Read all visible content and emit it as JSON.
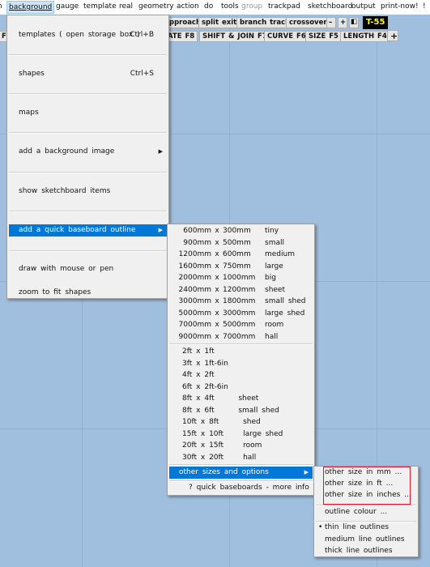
{
  "menubar": {
    "items": [
      {
        "label": "n"
      },
      {
        "label": "background"
      },
      {
        "label": "gauge"
      },
      {
        "label": "template"
      },
      {
        "label": "real"
      },
      {
        "label": "geometry"
      },
      {
        "label": "action"
      },
      {
        "label": "do"
      },
      {
        "label": "tools"
      },
      {
        "label": "group"
      },
      {
        "label": "trackpad"
      },
      {
        "label": "sketchboard"
      },
      {
        "label": "output"
      },
      {
        "label": "print-now!"
      },
      {
        "label": "!"
      }
    ]
  },
  "toolbar1": {
    "approach": "pproach",
    "split_exit": "split exit",
    "branch_track": "branch track",
    "crossover": "crossover",
    "minus": "–",
    "plus": "+",
    "fit": "◧",
    "badge": "T-55",
    "badge_bg": "#000000",
    "badge_fg": "#ffff00"
  },
  "toolbar2": {
    "left": "F|",
    "rotate": "ATE F8",
    "shift_join": "SHIFT & JOIN F7",
    "curve": "CURVE F6",
    "size": "SIZE F5",
    "length": "LENGTH F4",
    "add": "+"
  },
  "background_menu": {
    "items": [
      {
        "label": "templates ( open storage box )",
        "shortcut": "Ctrl+B"
      },
      {
        "label": "shapes",
        "shortcut": "Ctrl+S"
      },
      {
        "label": "maps"
      },
      {
        "label": "add a background image"
      },
      {
        "label": "show sketchboard items"
      },
      {
        "label": "add a quick baseboard outline"
      },
      {
        "label": "draw with mouse or pen"
      },
      {
        "label": "zoom to fit shapes"
      }
    ]
  },
  "baseboard_menu": {
    "metric": [
      {
        "w": "600mm",
        "h": "300mm",
        "name": "tiny"
      },
      {
        "w": "900mm",
        "h": "500mm",
        "name": "small"
      },
      {
        "w": "1200mm",
        "h": "600mm",
        "name": "medium"
      },
      {
        "w": "1600mm",
        "h": "750mm",
        "name": "large"
      },
      {
        "w": "2000mm",
        "h": "1000mm",
        "name": "big"
      },
      {
        "w": "2400mm",
        "h": "1200mm",
        "name": "sheet"
      },
      {
        "w": "3000mm",
        "h": "1800mm",
        "name": "small shed"
      },
      {
        "w": "5000mm",
        "h": "3000mm",
        "name": "large shed"
      },
      {
        "w": "7000mm",
        "h": "5000mm",
        "name": "room"
      },
      {
        "w": "9000mm",
        "h": "7000mm",
        "name": "hall"
      }
    ],
    "imperial": [
      {
        "w": "2ft",
        "h": "1ft",
        "name": ""
      },
      {
        "w": "3ft",
        "h": "1ft-6in",
        "name": ""
      },
      {
        "w": "4ft",
        "h": "2ft",
        "name": ""
      },
      {
        "w": "6ft",
        "h": "2ft-6in",
        "name": ""
      },
      {
        "w": "8ft",
        "h": "4ft",
        "name": "sheet"
      },
      {
        "w": "8ft",
        "h": "6ft",
        "name": "small shed"
      },
      {
        "w": "10ft",
        "h": "8ft",
        "name": "shed"
      },
      {
        "w": "15ft",
        "h": "10ft",
        "name": "large shed"
      },
      {
        "w": "20ft",
        "h": "15ft",
        "name": "room"
      },
      {
        "w": "30ft",
        "h": "20ft",
        "name": "hall"
      }
    ],
    "x": "x",
    "other": "other sizes and options",
    "info": "? quick baseboards - more info"
  },
  "options_menu": {
    "mm": "other size in mm ...",
    "ft": "other size in ft ...",
    "inches": "other size in inches ...",
    "colour": "outline colour ...",
    "thin": "thin line outlines",
    "medium": "medium line outlines",
    "thick": "thick line outlines",
    "bullet": "•",
    "highlight_color": "#e81123"
  }
}
